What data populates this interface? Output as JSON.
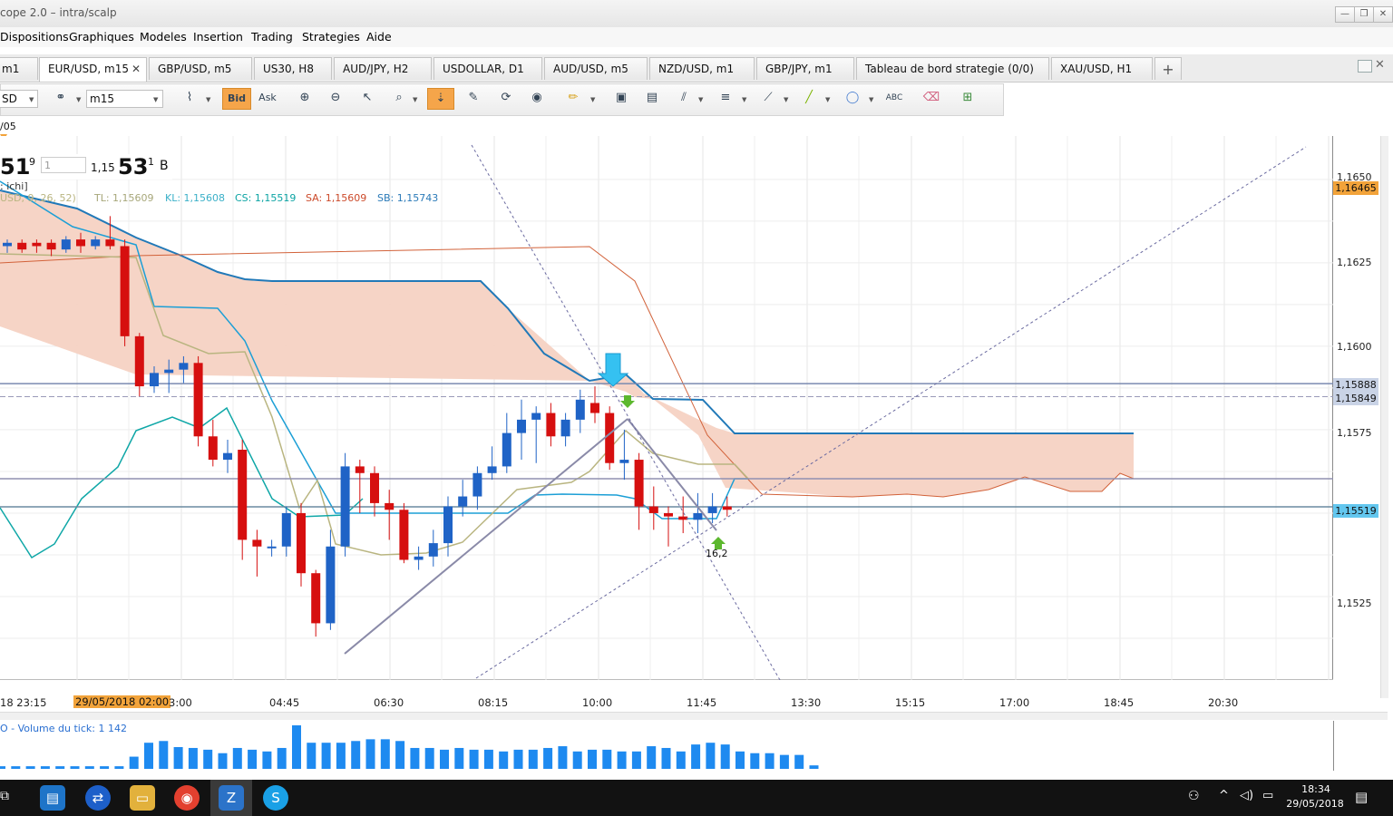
{
  "window": {
    "title": "cope 2.0 – intra/scalp",
    "min": "—",
    "restore": "❐",
    "close": "✕"
  },
  "menu": [
    "Dispositions",
    "Graphiques",
    "Modeles",
    "Insertion",
    "Trading",
    "Strategies",
    "Aide"
  ],
  "tabs": [
    {
      "label": "m1"
    },
    {
      "label": "EUR/USD, m15",
      "close": "✕"
    },
    {
      "label": "GBP/USD, m5"
    },
    {
      "label": "US30, H8"
    },
    {
      "label": "AUD/JPY, H2"
    },
    {
      "label": "USDOLLAR, D1"
    },
    {
      "label": "AUD/USD, m5"
    },
    {
      "label": "NZD/USD, m1"
    },
    {
      "label": "GBP/JPY, m1"
    },
    {
      "label": "Tableau de bord strategie (0/0)"
    },
    {
      "label": "XAU/USD, H1"
    },
    {
      "label": "+"
    }
  ],
  "toolbar": {
    "symbol": "SD",
    "timeframe": "m15",
    "bid": "Bid",
    "ask": "Ask"
  },
  "quote": {
    "date_marker": "/05",
    "big": "51",
    "sup": "9",
    "qty": "1",
    "price_prefix": "1,15",
    "price_big": "53",
    "price_sup": "1",
    "side": "B"
  },
  "indicator": {
    "name": ": ichi]",
    "params": "USD, 9, 26, 52)",
    "tl": "TL: 1,15609",
    "kl": "KL: 1,15608",
    "cs": "CS: 1,15519",
    "sa": "SA: 1,15609",
    "sb": "SB: 1,15743"
  },
  "annotation": "16,2",
  "price_axis": {
    "ticks": [
      "1,1650",
      "1,1625",
      "1,1600",
      "1,1575",
      "1,1525"
    ],
    "tags": [
      {
        "text": "1,16465",
        "color": "#f2a33a"
      },
      {
        "text": "1,15888",
        "color": "#c9d3e6"
      },
      {
        "text": "1,15849",
        "color": "#c9d3e6"
      },
      {
        "text": "1,15519",
        "color": "#63c7ef"
      }
    ]
  },
  "time_axis": {
    "ticks": [
      "18 23:15",
      "3:00",
      "04:45",
      "06:30",
      "08:15",
      "10:00",
      "11:45",
      "13:30",
      "15:15",
      "17:00",
      "18:45",
      "20:30"
    ],
    "highlight": "29/05/2018 02:00"
  },
  "volume": {
    "label": "O - Volume du tick: 1 142",
    "bars": [
      3,
      3,
      3,
      3,
      3,
      3,
      3,
      3,
      3,
      14,
      30,
      32,
      25,
      24,
      22,
      18,
      24,
      22,
      20,
      24,
      50,
      30,
      30,
      30,
      32,
      34,
      34,
      32,
      24,
      24,
      22,
      24,
      22,
      22,
      20,
      22,
      22,
      24,
      26,
      20,
      22,
      22,
      20,
      20,
      26,
      24,
      20,
      28,
      30,
      28,
      20,
      18,
      18,
      16,
      16,
      4
    ]
  },
  "chart_data": {
    "type": "candlestick",
    "series_params": "EUR/USD m15 Ichimoku",
    "candles": [
      {
        "o": 1.163,
        "h": 1.1632,
        "l": 1.1628,
        "c": 1.1631
      },
      {
        "o": 1.1631,
        "h": 1.1632,
        "l": 1.1628,
        "c": 1.1629
      },
      {
        "o": 1.1631,
        "h": 1.1632,
        "l": 1.1628,
        "c": 1.163
      },
      {
        "o": 1.1631,
        "h": 1.1632,
        "l": 1.1627,
        "c": 1.1629
      },
      {
        "o": 1.1629,
        "h": 1.1633,
        "l": 1.1628,
        "c": 1.1632
      },
      {
        "o": 1.1632,
        "h": 1.1634,
        "l": 1.1628,
        "c": 1.163
      },
      {
        "o": 1.163,
        "h": 1.1633,
        "l": 1.1629,
        "c": 1.1632
      },
      {
        "o": 1.1632,
        "h": 1.1639,
        "l": 1.1629,
        "c": 1.163
      },
      {
        "o": 1.163,
        "h": 1.1632,
        "l": 1.16,
        "c": 1.1603
      },
      {
        "o": 1.1603,
        "h": 1.1604,
        "l": 1.1585,
        "c": 1.1588
      },
      {
        "o": 1.1588,
        "h": 1.1594,
        "l": 1.1586,
        "c": 1.1592
      },
      {
        "o": 1.1592,
        "h": 1.1596,
        "l": 1.1586,
        "c": 1.1593
      },
      {
        "o": 1.1593,
        "h": 1.1597,
        "l": 1.1589,
        "c": 1.1595
      },
      {
        "o": 1.1595,
        "h": 1.1597,
        "l": 1.157,
        "c": 1.1573
      },
      {
        "o": 1.1573,
        "h": 1.1578,
        "l": 1.1564,
        "c": 1.1566
      },
      {
        "o": 1.1566,
        "h": 1.1572,
        "l": 1.1562,
        "c": 1.1568
      },
      {
        "o": 1.1569,
        "h": 1.1572,
        "l": 1.1536,
        "c": 1.1542
      },
      {
        "o": 1.1542,
        "h": 1.1545,
        "l": 1.1531,
        "c": 1.154
      },
      {
        "o": 1.154,
        "h": 1.1542,
        "l": 1.1537,
        "c": 1.154
      },
      {
        "o": 1.154,
        "h": 1.1552,
        "l": 1.1537,
        "c": 1.155
      },
      {
        "o": 1.155,
        "h": 1.1553,
        "l": 1.1528,
        "c": 1.1532
      },
      {
        "o": 1.1532,
        "h": 1.1533,
        "l": 1.1513,
        "c": 1.1517
      },
      {
        "o": 1.1517,
        "h": 1.1545,
        "l": 1.1515,
        "c": 1.154
      },
      {
        "o": 1.154,
        "h": 1.1568,
        "l": 1.1537,
        "c": 1.1564
      },
      {
        "o": 1.1564,
        "h": 1.1566,
        "l": 1.155,
        "c": 1.1562
      },
      {
        "o": 1.1562,
        "h": 1.1564,
        "l": 1.1549,
        "c": 1.1553
      },
      {
        "o": 1.1553,
        "h": 1.1557,
        "l": 1.1542,
        "c": 1.1551
      },
      {
        "o": 1.1551,
        "h": 1.1553,
        "l": 1.1535,
        "c": 1.1536
      },
      {
        "o": 1.1536,
        "h": 1.154,
        "l": 1.1533,
        "c": 1.1537
      },
      {
        "o": 1.1537,
        "h": 1.1545,
        "l": 1.1534,
        "c": 1.1541
      },
      {
        "o": 1.1541,
        "h": 1.1555,
        "l": 1.1537,
        "c": 1.1552
      },
      {
        "o": 1.1552,
        "h": 1.156,
        "l": 1.1549,
        "c": 1.1555
      },
      {
        "o": 1.1555,
        "h": 1.1564,
        "l": 1.1551,
        "c": 1.1562
      },
      {
        "o": 1.1562,
        "h": 1.157,
        "l": 1.156,
        "c": 1.1564
      },
      {
        "o": 1.1564,
        "h": 1.158,
        "l": 1.1562,
        "c": 1.1574
      },
      {
        "o": 1.1574,
        "h": 1.1584,
        "l": 1.1566,
        "c": 1.1578
      },
      {
        "o": 1.1578,
        "h": 1.1582,
        "l": 1.1565,
        "c": 1.158
      },
      {
        "o": 1.158,
        "h": 1.1583,
        "l": 1.157,
        "c": 1.1573
      },
      {
        "o": 1.1573,
        "h": 1.158,
        "l": 1.157,
        "c": 1.1578
      },
      {
        "o": 1.1578,
        "h": 1.1587,
        "l": 1.1574,
        "c": 1.1584
      },
      {
        "o": 1.1583,
        "h": 1.1588,
        "l": 1.1577,
        "c": 1.158
      },
      {
        "o": 1.158,
        "h": 1.1582,
        "l": 1.1563,
        "c": 1.1565
      },
      {
        "o": 1.1565,
        "h": 1.1575,
        "l": 1.156,
        "c": 1.1566
      },
      {
        "o": 1.1566,
        "h": 1.1568,
        "l": 1.1545,
        "c": 1.1552
      },
      {
        "o": 1.1552,
        "h": 1.1558,
        "l": 1.1545,
        "c": 1.155
      },
      {
        "o": 1.155,
        "h": 1.1552,
        "l": 1.154,
        "c": 1.1549
      },
      {
        "o": 1.1549,
        "h": 1.1555,
        "l": 1.1544,
        "c": 1.1548
      },
      {
        "o": 1.1548,
        "h": 1.1556,
        "l": 1.1544,
        "c": 1.155
      },
      {
        "o": 1.155,
        "h": 1.1556,
        "l": 1.1547,
        "c": 1.1552
      },
      {
        "o": 1.1552,
        "h": 1.1555,
        "l": 1.1549,
        "c": 1.1551
      }
    ],
    "ylim": [
      1.15,
      1.1663
    ],
    "levels": [
      1.15888,
      1.15849,
      1.15519
    ],
    "kumo_future_top": 1.15743,
    "colors": {
      "up": "#1f63c6",
      "down": "#d60f0f",
      "tenkan": "#b9b580",
      "kijun": "#1c9fd6",
      "chikou": "#0fa7a7",
      "ssb": "#2179b8",
      "kumo": "#f5d2c3"
    }
  }
}
